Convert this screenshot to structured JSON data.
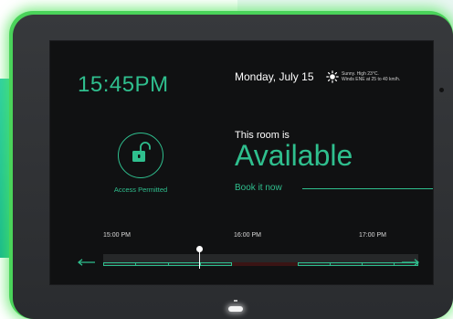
{
  "status_bar": {
    "time": "15:45PM",
    "date": "Monday, July 15",
    "weather_line1": "Sunny. High 23°C.",
    "weather_line2": "Winds ENE at 25 to 40 km/h.",
    "weather_icon": "sun-icon"
  },
  "access": {
    "icon": "unlocked-padlock-icon",
    "label": "Access Permitted"
  },
  "room": {
    "label": "This room is",
    "status": "Available",
    "book_label": "Book it now"
  },
  "timeline": {
    "labels": [
      "15:00 PM",
      "16:00 PM",
      "17:00 PM"
    ],
    "prev_icon": "arrow-left-icon",
    "next_icon": "arrow-right-icon"
  },
  "colors": {
    "accent": "#2fbf8e",
    "tablet_glow": "#4ad35a",
    "busy": "#3a1414"
  }
}
